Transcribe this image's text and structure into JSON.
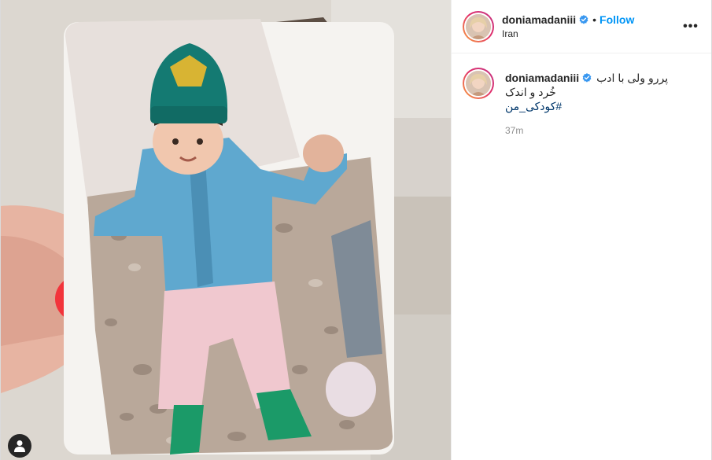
{
  "post": {
    "username": "doniamadaniii",
    "follow_label": "Follow",
    "separator": "•",
    "location": "Iran",
    "more_label": "•••"
  },
  "caption": {
    "username": "doniamadaniii",
    "line1": "پررو ولی با ادب",
    "line2": "خُرد و اندک",
    "hashtag": "#کودکی_من",
    "timestamp": "37m"
  },
  "icons": {
    "verified": "verified-badge-icon",
    "more": "more-options-icon",
    "user_tag": "user-tag-icon"
  },
  "colors": {
    "link": "#0095f6",
    "verified": "#3897f0",
    "hashtag": "#00376b"
  }
}
